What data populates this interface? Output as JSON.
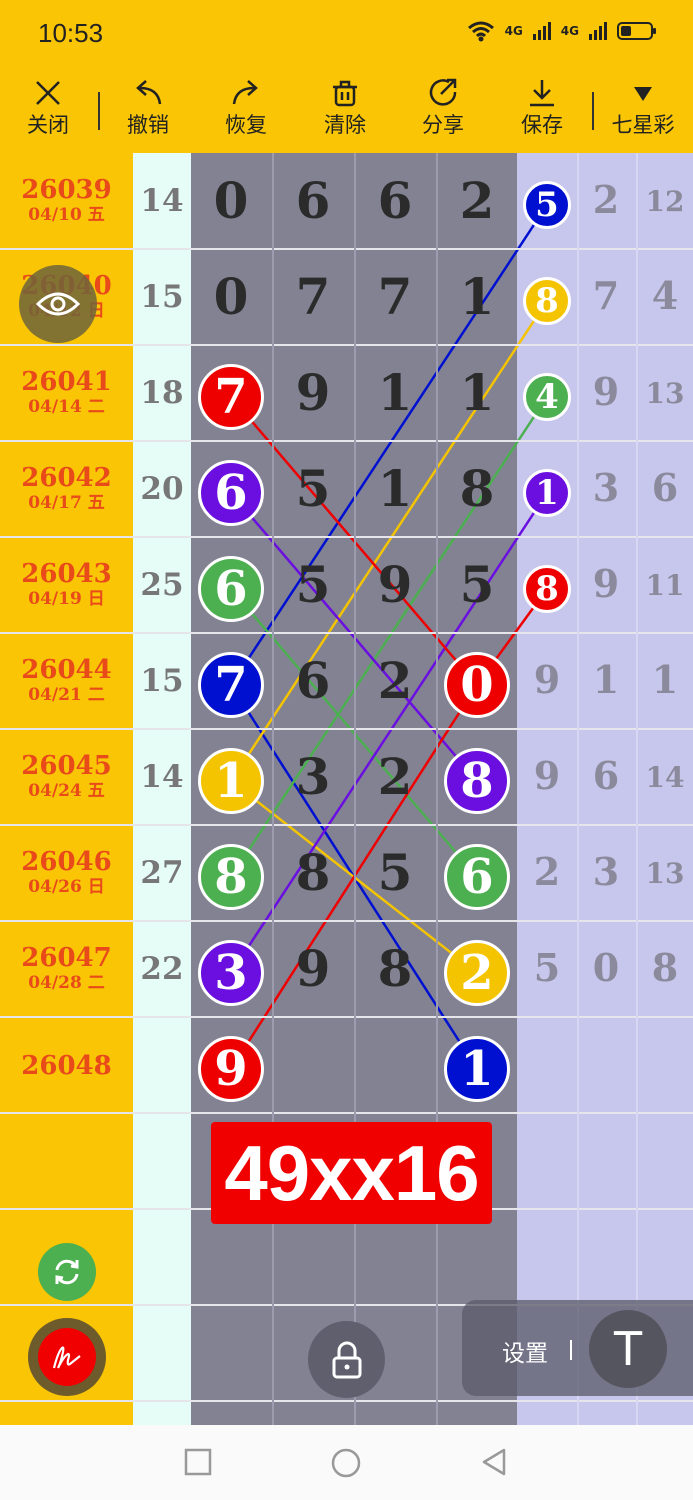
{
  "status_bar": {
    "time": "10:53",
    "net1": "4G",
    "net2": "4G"
  },
  "toolbar": [
    {
      "id": "close",
      "label": "关闭"
    },
    {
      "id": "undo",
      "label": "撤销"
    },
    {
      "id": "redo",
      "label": "恢复"
    },
    {
      "id": "clear",
      "label": "清除"
    },
    {
      "id": "share",
      "label": "分享"
    },
    {
      "id": "save",
      "label": "保存"
    },
    {
      "id": "lottery",
      "label": "七星彩"
    }
  ],
  "rows": [
    {
      "issue": "26039",
      "date": "04/10 五",
      "sum": "14",
      "digits": [
        "0",
        "6",
        "6",
        "2"
      ],
      "ball": {
        "col": 4,
        "value": "5",
        "color": "#0010D0"
      },
      "right": [
        "2",
        "12"
      ]
    },
    {
      "issue": "26040",
      "date": "04/12 日",
      "sum": "15",
      "digits": [
        "0",
        "7",
        "7",
        "1"
      ],
      "ball": {
        "col": 4,
        "value": "8",
        "color": "#F5C400"
      },
      "right": [
        "7",
        "4"
      ]
    },
    {
      "issue": "26041",
      "date": "04/14 二",
      "sum": "18",
      "digits": [
        "7",
        "9",
        "1",
        "1"
      ],
      "ball": {
        "col": 4,
        "value": "4",
        "color": "#4CAF50"
      },
      "right": [
        "9",
        "13"
      ]
    },
    {
      "issue": "26042",
      "date": "04/17 五",
      "sum": "20",
      "digits": [
        "6",
        "5",
        "1",
        "8"
      ],
      "ball": {
        "col": 4,
        "value": "1",
        "color": "#6A0FE0"
      },
      "right": [
        "3",
        "6"
      ]
    },
    {
      "issue": "26043",
      "date": "04/19 日",
      "sum": "25",
      "digits": [
        "6",
        "5",
        "9",
        "5"
      ],
      "ball": {
        "col": 4,
        "value": "8",
        "color": "#EE0000"
      },
      "right": [
        "9",
        "11"
      ]
    },
    {
      "issue": "26044",
      "date": "04/21 二",
      "sum": "15",
      "digits": [
        "7",
        "6",
        "2",
        "0"
      ],
      "ball": null,
      "right": [
        "9",
        "1",
        "1"
      ]
    },
    {
      "issue": "26045",
      "date": "04/24 五",
      "sum": "14",
      "digits": [
        "1",
        "3",
        "2",
        "8"
      ],
      "ball": null,
      "right": [
        "9",
        "6",
        "14"
      ]
    },
    {
      "issue": "26046",
      "date": "04/26 日",
      "sum": "27",
      "digits": [
        "8",
        "8",
        "5",
        "6"
      ],
      "ball": null,
      "right": [
        "2",
        "3",
        "13"
      ]
    },
    {
      "issue": "26047",
      "date": "04/28 二",
      "sum": "22",
      "digits": [
        "3",
        "9",
        "8",
        "2"
      ],
      "ball": null,
      "right": [
        "5",
        "0",
        "8"
      ]
    },
    {
      "issue": "26048",
      "date": "",
      "sum": "",
      "digits": [
        "9",
        "",
        "",
        "1"
      ],
      "ball": null,
      "right": []
    }
  ],
  "circled": [
    {
      "row": 2,
      "col": 0,
      "value": "7",
      "color": "#EE0000"
    },
    {
      "row": 3,
      "col": 0,
      "value": "6",
      "color": "#6A0FE0"
    },
    {
      "row": 4,
      "col": 0,
      "value": "6",
      "color": "#4CAF50"
    },
    {
      "row": 5,
      "col": 0,
      "value": "7",
      "color": "#0010D0"
    },
    {
      "row": 5,
      "col": 3,
      "value": "0",
      "color": "#EE0000"
    },
    {
      "row": 6,
      "col": 0,
      "value": "1",
      "color": "#F5C400"
    },
    {
      "row": 6,
      "col": 3,
      "value": "8",
      "color": "#6A0FE0"
    },
    {
      "row": 7,
      "col": 0,
      "value": "8",
      "color": "#4CAF50"
    },
    {
      "row": 7,
      "col": 3,
      "value": "6",
      "color": "#4CAF50"
    },
    {
      "row": 8,
      "col": 0,
      "value": "3",
      "color": "#6A0FE0"
    },
    {
      "row": 8,
      "col": 3,
      "value": "2",
      "color": "#F5C400"
    },
    {
      "row": 9,
      "col": 0,
      "value": "9",
      "color": "#EE0000"
    },
    {
      "row": 9,
      "col": 3,
      "value": "1",
      "color": "#0010D0"
    }
  ],
  "lines": [
    {
      "color": "#0010D0",
      "from": [
        0,
        4
      ],
      "to": [
        5,
        0
      ]
    },
    {
      "color": "#0010D0",
      "from": [
        5,
        0
      ],
      "to": [
        9,
        3
      ]
    },
    {
      "color": "#F5C400",
      "from": [
        1,
        4
      ],
      "to": [
        6,
        0
      ]
    },
    {
      "color": "#F5C400",
      "from": [
        6,
        0
      ],
      "to": [
        8,
        3
      ]
    },
    {
      "color": "#4CAF50",
      "from": [
        2,
        4
      ],
      "to": [
        7,
        0
      ]
    },
    {
      "color": "#4CAF50",
      "from": [
        4,
        0
      ],
      "to": [
        7,
        3
      ]
    },
    {
      "color": "#6A0FE0",
      "from": [
        3,
        4
      ],
      "to": [
        8,
        0
      ]
    },
    {
      "color": "#6A0FE0",
      "from": [
        3,
        0
      ],
      "to": [
        6,
        3
      ]
    },
    {
      "color": "#EE0000",
      "from": [
        4,
        4
      ],
      "to": [
        5,
        3
      ]
    },
    {
      "color": "#EE0000",
      "from": [
        5,
        3
      ],
      "to": [
        9,
        0
      ]
    },
    {
      "color": "#EE0000",
      "from": [
        2,
        0
      ],
      "to": [
        5,
        3
      ]
    }
  ],
  "prediction": "49xx16",
  "settings_label": "设置",
  "text_tool_label": "T",
  "icons": [
    "close-icon",
    "undo-icon",
    "redo-icon",
    "trash-icon",
    "share-icon",
    "download-icon",
    "dropdown-icon",
    "eye-icon",
    "refresh-icon",
    "pen-icon",
    "lock-icon",
    "text-tool-icon"
  ]
}
